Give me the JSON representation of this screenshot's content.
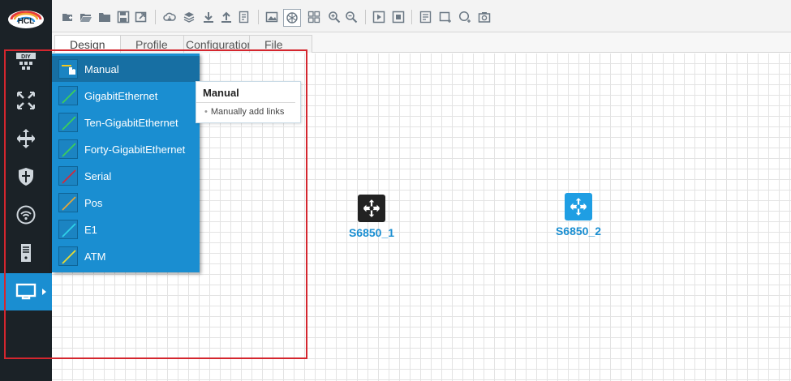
{
  "app": {
    "logo_text": "HCL"
  },
  "tabs": [
    {
      "label": "Design",
      "active": true
    },
    {
      "label": "Profile",
      "active": false
    },
    {
      "label": "Configuration",
      "active": false
    },
    {
      "label": "File",
      "active": false
    }
  ],
  "sidebar": {
    "items": [
      {
        "icon": "diy-icon",
        "label": "DIY"
      },
      {
        "icon": "router-icon"
      },
      {
        "icon": "switch-icon"
      },
      {
        "icon": "firewall-icon"
      },
      {
        "icon": "wireless-icon"
      },
      {
        "icon": "host-icon"
      },
      {
        "icon": "connection-icon",
        "active": true
      }
    ]
  },
  "link_menu": {
    "items": [
      {
        "label": "Manual",
        "color": "#f2c81e"
      },
      {
        "label": "GigabitEthernet",
        "color": "#3ccf5a"
      },
      {
        "label": "Ten-GigabitEthernet",
        "color": "#3ccf5a"
      },
      {
        "label": "Forty-GigabitEthernet",
        "color": "#3ccf5a"
      },
      {
        "label": "Serial",
        "color": "#d3283c"
      },
      {
        "label": "Pos",
        "color": "#e0a63c"
      },
      {
        "label": "E1",
        "color": "#2fd2e8"
      },
      {
        "label": "ATM",
        "color": "#e8dc32"
      }
    ]
  },
  "tooltip": {
    "title": "Manual",
    "body": "Manually add links"
  },
  "devices": [
    {
      "label": "S6850_1",
      "color": "#222222"
    },
    {
      "label": "S6850_2",
      "color": "#1f9ee3"
    }
  ],
  "colors": {
    "accent": "#1a8ed1",
    "sidebar_bg": "#1b2227",
    "highlight": "#d4262e"
  }
}
